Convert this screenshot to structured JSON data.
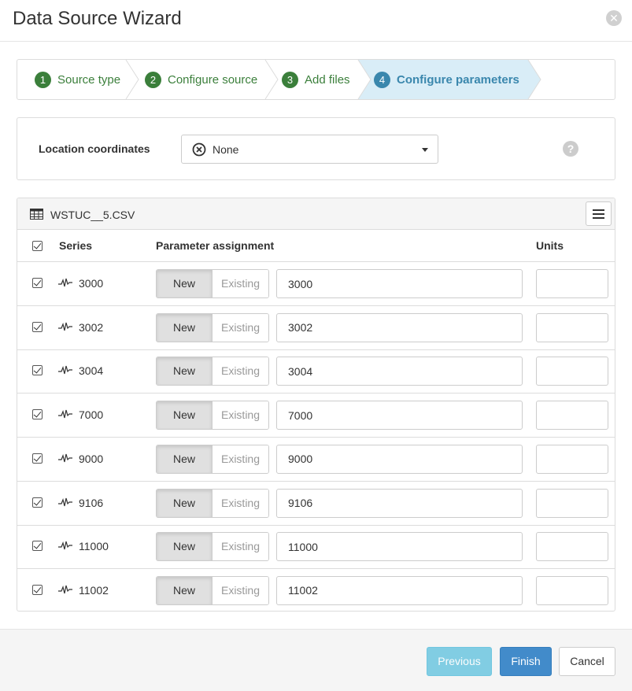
{
  "dialog": {
    "title": "Data Source Wizard"
  },
  "steps": [
    {
      "num": "1",
      "label": "Source type"
    },
    {
      "num": "2",
      "label": "Configure source"
    },
    {
      "num": "3",
      "label": "Add files"
    },
    {
      "num": "4",
      "label": "Configure parameters"
    }
  ],
  "colors": {
    "done": "#3b7f3b",
    "active": "#3a87ad",
    "active_bg": "#d9edf7"
  },
  "location": {
    "label": "Location coordinates",
    "value": "None"
  },
  "file": {
    "name": "WSTUC__5.CSV",
    "headers": {
      "series": "Series",
      "parameter": "Parameter assignment",
      "units": "Units"
    },
    "toggle": {
      "new": "New",
      "existing": "Existing"
    },
    "rows": [
      {
        "series": "3000",
        "param": "3000",
        "units": ""
      },
      {
        "series": "3002",
        "param": "3002",
        "units": ""
      },
      {
        "series": "3004",
        "param": "3004",
        "units": ""
      },
      {
        "series": "7000",
        "param": "7000",
        "units": ""
      },
      {
        "series": "9000",
        "param": "9000",
        "units": ""
      },
      {
        "series": "9106",
        "param": "9106",
        "units": ""
      },
      {
        "series": "11000",
        "param": "11000",
        "units": ""
      },
      {
        "series": "11002",
        "param": "11002",
        "units": ""
      }
    ]
  },
  "footer": {
    "previous": "Previous",
    "finish": "Finish",
    "cancel": "Cancel"
  }
}
